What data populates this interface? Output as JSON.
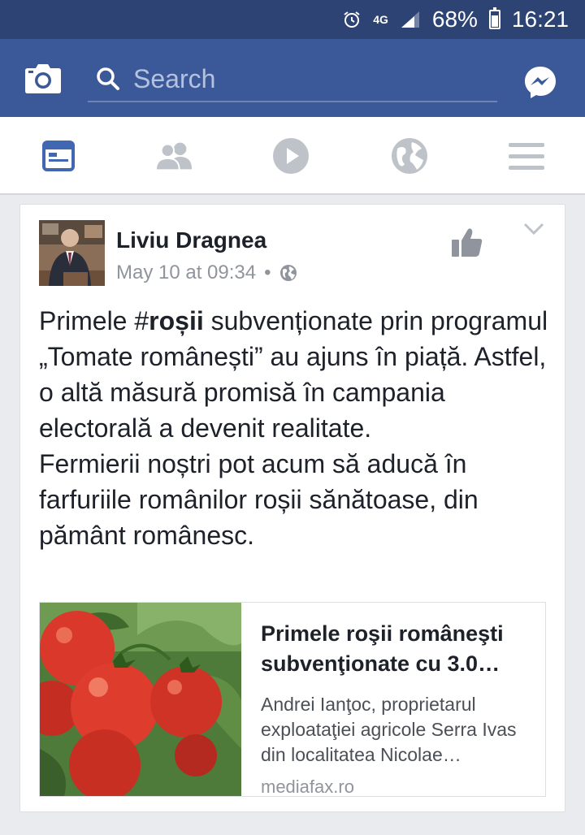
{
  "status_bar": {
    "network": "4G",
    "battery_percent": "68%",
    "battery_level": 0.68,
    "time": "16:21",
    "icons": [
      "alarm-icon",
      "signal-icon",
      "battery-icon"
    ]
  },
  "top_bar": {
    "search_placeholder": "Search",
    "icons": [
      "camera-icon",
      "search-icon",
      "messenger-icon"
    ],
    "color": "#3b5998"
  },
  "nav_tabs": [
    {
      "name": "news-feed",
      "icon": "news-feed-icon",
      "active": true
    },
    {
      "name": "friends",
      "icon": "friends-icon",
      "active": false
    },
    {
      "name": "video",
      "icon": "video-icon",
      "active": false
    },
    {
      "name": "notifications",
      "icon": "globe-icon",
      "active": false
    },
    {
      "name": "menu",
      "icon": "menu-icon",
      "active": false
    }
  ],
  "post": {
    "author": "Liviu Dragnea",
    "date": "May 10 at 09:34",
    "separator": "•",
    "privacy_icon": "globe-icon",
    "text_before": "Primele #",
    "hashtag": "roșii",
    "text_line1_after": " subvenționate prin programul „Tomate românești” au ajuns în piață. Astfel, o altă măsură promisă în campania electorală a devenit realitate.",
    "text_paragraph2": "Fermierii noștri pot acum să aducă în farfuriile românilor roșii sănătoase, din pământ românesc.",
    "link": {
      "title": "Primele roşii româneşti subvenţionate cu 3.0…",
      "description": "Andrei Ianţoc, proprietarul exploataţiei agricole Serra Ivas din localitatea Nicolae…",
      "domain": "mediafax.ro"
    }
  }
}
